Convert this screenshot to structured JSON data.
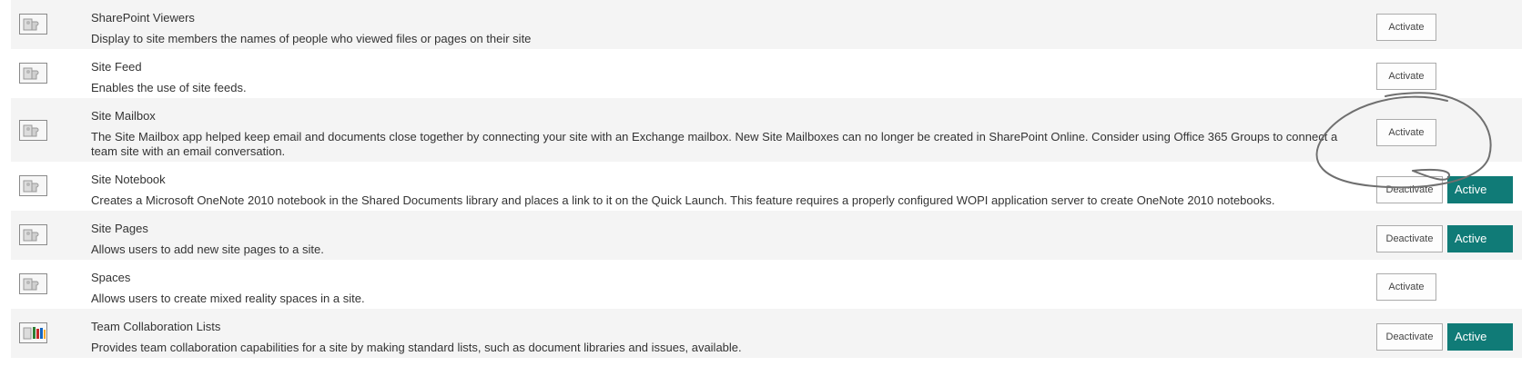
{
  "features": [
    {
      "title": "SharePoint Viewers",
      "description": "Display to site members the names of people who viewed files or pages on their site",
      "icon": "puzzle-feature-icon",
      "button": "Activate",
      "status": null
    },
    {
      "title": "Site Feed",
      "description": "Enables the use of site feeds.",
      "icon": "puzzle-feature-icon",
      "button": "Activate",
      "status": null
    },
    {
      "title": "Site Mailbox",
      "description": "The Site Mailbox app helped keep email and documents close together by connecting your site with an Exchange mailbox. New Site Mailboxes can no longer be created in SharePoint Online. Consider using Office 365 Groups to connect a team site with an email conversation.",
      "icon": "puzzle-feature-icon",
      "button": "Activate",
      "status": null
    },
    {
      "title": "Site Notebook",
      "description": "Creates a Microsoft OneNote 2010 notebook in the Shared Documents library and places a link to it on the Quick Launch. This feature requires a properly configured WOPI application server to create OneNote 2010 notebooks.",
      "icon": "puzzle-feature-icon",
      "button": "Deactivate",
      "status": "Active"
    },
    {
      "title": "Site Pages",
      "description": "Allows users to add new site pages to a site.",
      "icon": "puzzle-feature-icon",
      "button": "Deactivate",
      "status": "Active"
    },
    {
      "title": "Spaces",
      "description": "Allows users to create mixed reality spaces in a site.",
      "icon": "puzzle-feature-icon",
      "button": "Activate",
      "status": null
    },
    {
      "title": "Team Collaboration Lists",
      "description": "Provides team collaboration capabilities for a site by making standard lists, such as document libraries and issues, available.",
      "icon": "team-collaboration-icon",
      "button": "Deactivate",
      "status": "Active"
    }
  ],
  "colors": {
    "status_background": "#107b77",
    "row_alt_background": "#f4f4f4",
    "annotation_stroke": "#6f6f6f"
  },
  "annotation": "hand-drawn-circle-around-site-mailbox-activate-button"
}
